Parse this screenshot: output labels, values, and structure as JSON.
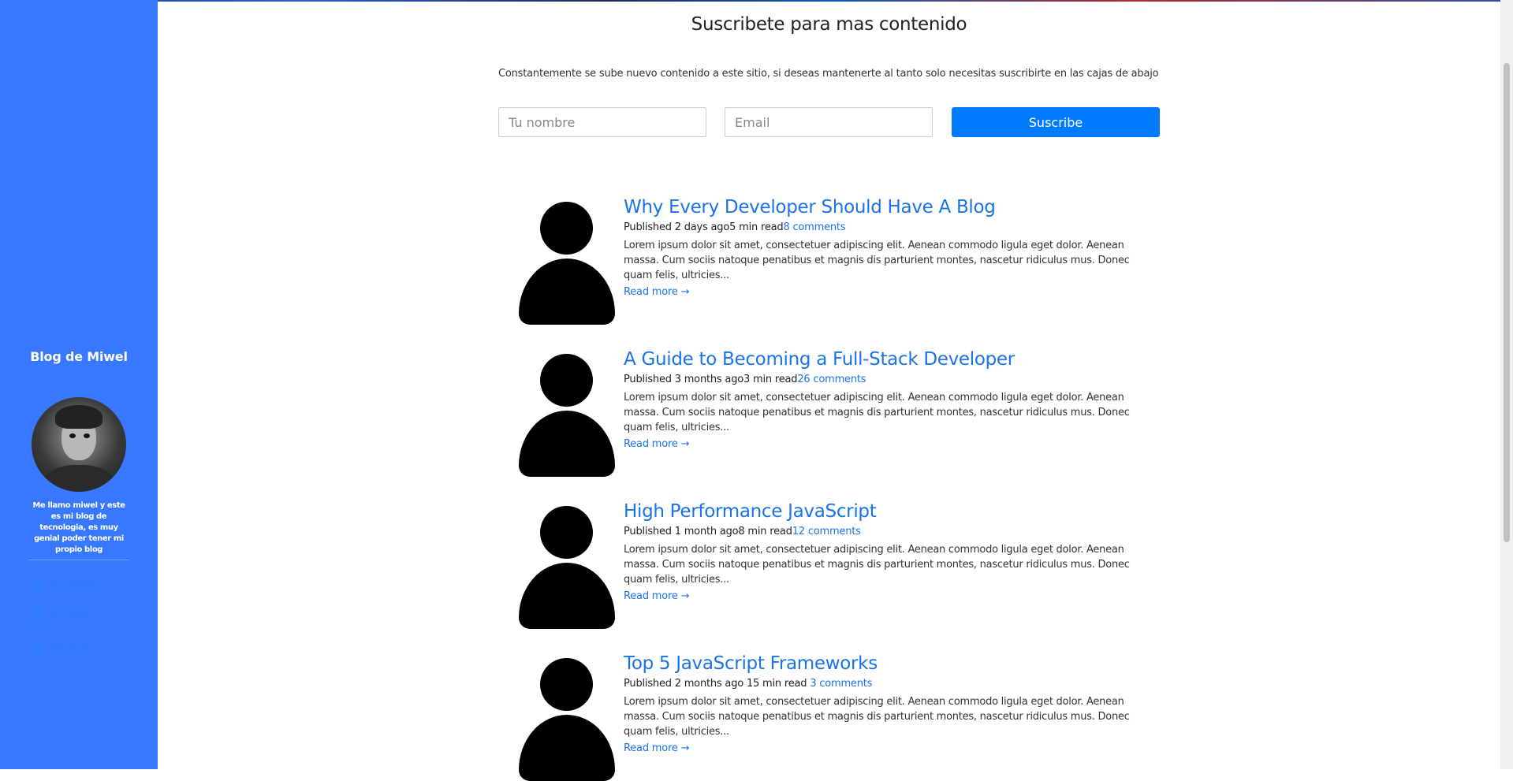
{
  "sidebar": {
    "blog_name": "Blog de Miwel",
    "bio": "Me llamo miwel y este es mi blog de tecnologia, es muy genial poder tener mi propio blog",
    "nav": [
      {
        "label": "Blog Home",
        "icon": "home-icon"
      },
      {
        "label": "Blog Post",
        "icon": "bookmark-icon"
      },
      {
        "label": "About Me",
        "icon": "user-icon"
      }
    ],
    "accent": "#3778ff"
  },
  "subscribe": {
    "title": "Suscribete para mas contenido",
    "description": "Constantemente se sube nuevo contenido a este sitio, si deseas mantenerte al tanto solo necesitas suscribirte en las cajas de abajo",
    "name_placeholder": "Tu nombre",
    "email_placeholder": "Email",
    "button_label": "Suscribe",
    "button_color": "#007bff"
  },
  "posts": [
    {
      "title": "Why Every Developer Should Have A Blog",
      "published": "Published 2 days ago",
      "read_time": "5 min read",
      "comments": "8 comments",
      "excerpt": "Lorem ipsum dolor sit amet, consectetuer adipiscing elit. Aenean commodo ligula eget dolor. Aenean massa. Cum sociis natoque penatibus et magnis dis parturient montes, nascetur ridiculus mus. Donec quam felis, ultricies...",
      "read_more": "Read more →"
    },
    {
      "title": "A Guide to Becoming a Full-Stack Developer",
      "published": "Published 3 months ago",
      "read_time": "3 min read",
      "comments": "26 comments",
      "excerpt": "Lorem ipsum dolor sit amet, consectetuer adipiscing elit. Aenean commodo ligula eget dolor. Aenean massa. Cum sociis natoque penatibus et magnis dis parturient montes, nascetur ridiculus mus. Donec quam felis, ultricies...",
      "read_more": "Read more →"
    },
    {
      "title": "High Performance JavaScript",
      "published": "Published 1 month ago",
      "read_time": "8 min read",
      "comments": "12 comments",
      "excerpt": "Lorem ipsum dolor sit amet, consectetuer adipiscing elit. Aenean commodo ligula eget dolor. Aenean massa. Cum sociis natoque penatibus et magnis dis parturient montes, nascetur ridiculus mus. Donec quam felis, ultricies...",
      "read_more": "Read more →"
    },
    {
      "title": "Top 5 JavaScript Frameworks",
      "published": "Published 2 months ago ",
      "read_time": "15 min read ",
      "comments": "3 comments",
      "excerpt": "Lorem ipsum dolor sit amet, consectetuer adipiscing elit. Aenean commodo ligula eget dolor. Aenean massa. Cum sociis natoque penatibus et magnis dis parturient montes, nascetur ridiculus mus. Donec quam felis, ultricies...",
      "read_more": "Read more →"
    }
  ]
}
